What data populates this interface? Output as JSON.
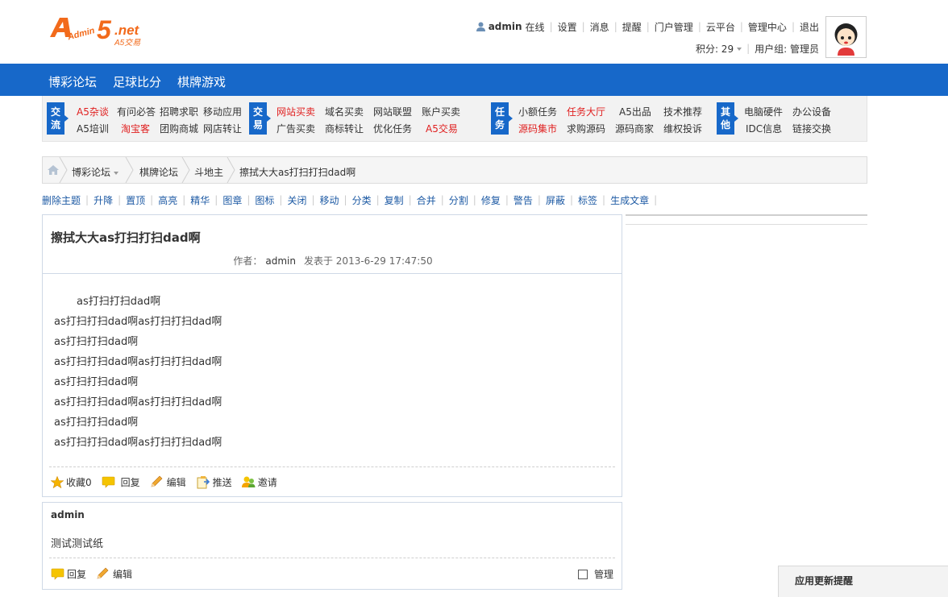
{
  "header": {
    "logo_main": "Admin",
    "logo_five": "5",
    "logo_net": ".net",
    "logo_sub": "A5交易",
    "user": {
      "name": "admin",
      "status": "在线",
      "links": [
        "设置",
        "消息",
        "提醒",
        "门户管理",
        "云平台",
        "管理中心",
        "退出"
      ],
      "points_label": "积分: 29",
      "group_label": "用户组: 管理员"
    }
  },
  "nav": {
    "items": [
      "博彩论坛",
      "足球比分",
      "棋牌游戏"
    ]
  },
  "categories": {
    "groups": [
      {
        "tag": [
          "交",
          "流"
        ],
        "rows": [
          [
            {
              "text": "A5杂谈",
              "red": true
            },
            {
              "text": "有问必答"
            },
            {
              "text": "招聘求职"
            },
            {
              "text": "移动应用"
            }
          ],
          [
            {
              "text": "A5培训"
            },
            {
              "text": "淘宝客",
              "red": true
            },
            {
              "text": "团购商城"
            },
            {
              "text": "网店转让"
            }
          ]
        ]
      },
      {
        "tag": [
          "交",
          "易"
        ],
        "rows": [
          [
            {
              "text": "网站买卖",
              "red": true
            },
            {
              "text": "域名买卖"
            },
            {
              "text": "网站联盟"
            },
            {
              "text": "账户买卖"
            }
          ],
          [
            {
              "text": "广告买卖"
            },
            {
              "text": "商标转让"
            },
            {
              "text": "优化任务"
            },
            {
              "text": "A5交易",
              "red": true
            }
          ]
        ]
      },
      {
        "tag": [
          "任",
          "务"
        ],
        "rows": [
          [
            {
              "text": "小额任务"
            },
            {
              "text": "任务大厅",
              "red": true
            },
            {
              "text": "A5出品"
            },
            {
              "text": "技术推荐"
            }
          ],
          [
            {
              "text": "源码集市",
              "red": true
            },
            {
              "text": "求购源码"
            },
            {
              "text": "源码商家"
            },
            {
              "text": "维权投诉"
            }
          ]
        ]
      },
      {
        "tag": [
          "其",
          "他"
        ],
        "rows": [
          [
            {
              "text": "电脑硬件"
            },
            {
              "text": "办公设备"
            }
          ],
          [
            {
              "text": "IDC信息"
            },
            {
              "text": "链接交换"
            }
          ]
        ]
      }
    ]
  },
  "breadcrumb": {
    "items": [
      "博彩论坛",
      "棋牌论坛",
      "斗地主",
      "擦拭大大as打扫打扫dad啊"
    ]
  },
  "mod_actions": [
    "删除主题",
    "升降",
    "置顶",
    "高亮",
    "精华",
    "图章",
    "图标",
    "关闭",
    "移动",
    "分类",
    "复制",
    "合并",
    "分割",
    "修复",
    "警告",
    "屏蔽",
    "标签",
    "生成文章"
  ],
  "thread": {
    "title": "擦拭大大as打扫打扫dad啊",
    "author_label": "作者：",
    "author": "admin",
    "posted": "发表于 2013-6-29 17:47:50",
    "body": [
      "as打扫打扫dad啊",
      "as打扫打扫dad啊as打扫打扫dad啊",
      "as打扫打扫dad啊",
      "as打扫打扫dad啊as打扫打扫dad啊",
      "as打扫打扫dad啊",
      "as打扫打扫dad啊as打扫打扫dad啊",
      "as打扫打扫dad啊",
      "as打扫打扫dad啊as打扫打扫dad啊"
    ],
    "actions": {
      "favorite": "收藏0",
      "reply": "回复",
      "edit": "编辑",
      "push": "推送",
      "invite": "邀请"
    }
  },
  "reply": {
    "author": "admin",
    "text": "测试测试纸",
    "actions": {
      "reply": "回复",
      "edit": "编辑"
    },
    "manage": "管理"
  },
  "update_panel": {
    "title": "应用更新提醒"
  },
  "colors": {
    "nav_bg": "#1768c9",
    "link_blue": "#1d5aa4",
    "hot_red": "#e02020",
    "logo_orange": "#f26a1b"
  }
}
